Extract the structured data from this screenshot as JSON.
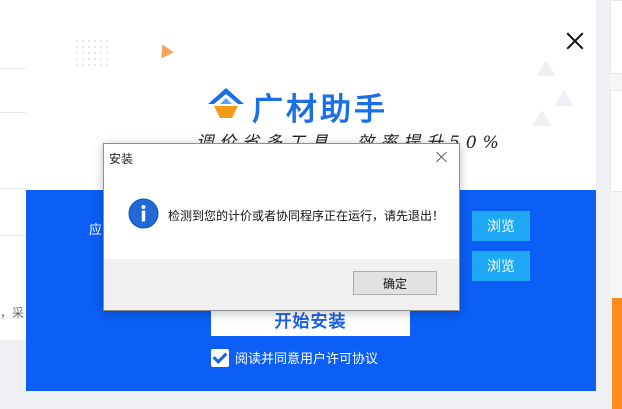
{
  "background": {
    "left_text": "，采"
  },
  "installer": {
    "brand": "广材助手",
    "slogan": "调价省多工具，效率提升50%",
    "row_label": "应",
    "browse_label": "浏览",
    "install_label": "开始安装",
    "agree_label": "阅读并同意用户许可协议",
    "agree_checked": true,
    "colors": {
      "blue": "#0b5ff6",
      "browse": "#1ea8f5",
      "logo_blue": "#1a6fe8",
      "logo_orange": "#f39a1b"
    }
  },
  "dialog": {
    "title": "安装",
    "message": "检测到您的计价或者协同程序正在运行，请先退出！",
    "ok_label": "确定",
    "icon": "info-icon"
  }
}
